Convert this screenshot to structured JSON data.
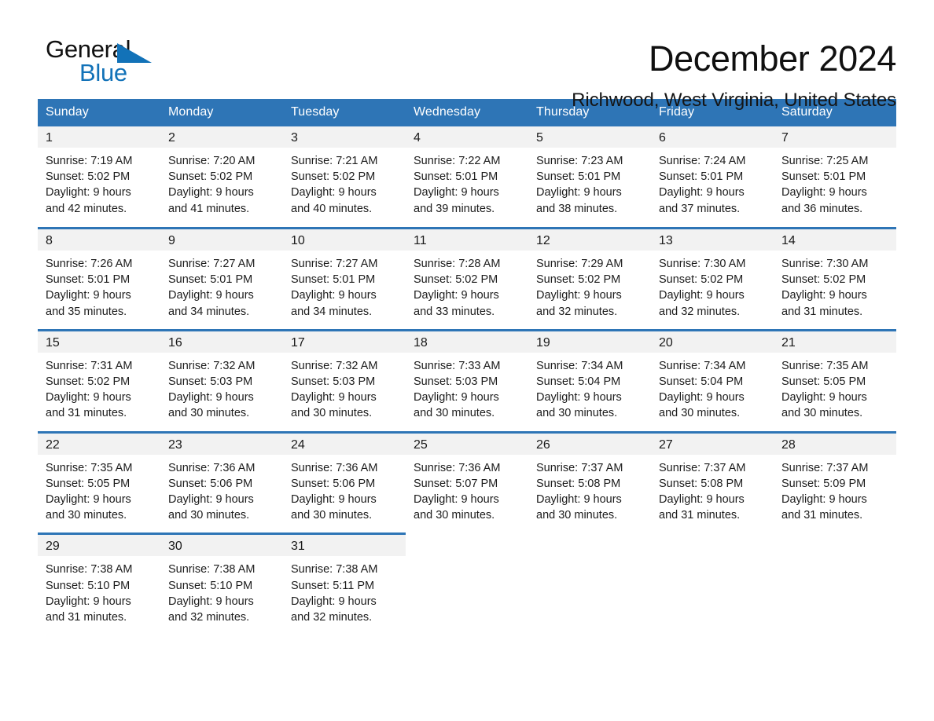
{
  "brand": {
    "word_one": "General",
    "word_two": "Blue",
    "accent_color": "#1272b8",
    "triangle_icon": "triangle-icon"
  },
  "header": {
    "month_title": "December 2024",
    "location": "Richwood, West Virginia, United States"
  },
  "theme": {
    "header_bar": "#2e75b6",
    "daynum_band": "#f2f2f2",
    "divider": "#2e75b6",
    "text": "#1a1a1a"
  },
  "weekday_headers": [
    "Sunday",
    "Monday",
    "Tuesday",
    "Wednesday",
    "Thursday",
    "Friday",
    "Saturday"
  ],
  "weeks": [
    [
      {
        "day": "1",
        "sunrise": "Sunrise: 7:19 AM",
        "sunset": "Sunset: 5:02 PM",
        "daylight_1": "Daylight: 9 hours",
        "daylight_2": "and 42 minutes."
      },
      {
        "day": "2",
        "sunrise": "Sunrise: 7:20 AM",
        "sunset": "Sunset: 5:02 PM",
        "daylight_1": "Daylight: 9 hours",
        "daylight_2": "and 41 minutes."
      },
      {
        "day": "3",
        "sunrise": "Sunrise: 7:21 AM",
        "sunset": "Sunset: 5:02 PM",
        "daylight_1": "Daylight: 9 hours",
        "daylight_2": "and 40 minutes."
      },
      {
        "day": "4",
        "sunrise": "Sunrise: 7:22 AM",
        "sunset": "Sunset: 5:01 PM",
        "daylight_1": "Daylight: 9 hours",
        "daylight_2": "and 39 minutes."
      },
      {
        "day": "5",
        "sunrise": "Sunrise: 7:23 AM",
        "sunset": "Sunset: 5:01 PM",
        "daylight_1": "Daylight: 9 hours",
        "daylight_2": "and 38 minutes."
      },
      {
        "day": "6",
        "sunrise": "Sunrise: 7:24 AM",
        "sunset": "Sunset: 5:01 PM",
        "daylight_1": "Daylight: 9 hours",
        "daylight_2": "and 37 minutes."
      },
      {
        "day": "7",
        "sunrise": "Sunrise: 7:25 AM",
        "sunset": "Sunset: 5:01 PM",
        "daylight_1": "Daylight: 9 hours",
        "daylight_2": "and 36 minutes."
      }
    ],
    [
      {
        "day": "8",
        "sunrise": "Sunrise: 7:26 AM",
        "sunset": "Sunset: 5:01 PM",
        "daylight_1": "Daylight: 9 hours",
        "daylight_2": "and 35 minutes."
      },
      {
        "day": "9",
        "sunrise": "Sunrise: 7:27 AM",
        "sunset": "Sunset: 5:01 PM",
        "daylight_1": "Daylight: 9 hours",
        "daylight_2": "and 34 minutes."
      },
      {
        "day": "10",
        "sunrise": "Sunrise: 7:27 AM",
        "sunset": "Sunset: 5:01 PM",
        "daylight_1": "Daylight: 9 hours",
        "daylight_2": "and 34 minutes."
      },
      {
        "day": "11",
        "sunrise": "Sunrise: 7:28 AM",
        "sunset": "Sunset: 5:02 PM",
        "daylight_1": "Daylight: 9 hours",
        "daylight_2": "and 33 minutes."
      },
      {
        "day": "12",
        "sunrise": "Sunrise: 7:29 AM",
        "sunset": "Sunset: 5:02 PM",
        "daylight_1": "Daylight: 9 hours",
        "daylight_2": "and 32 minutes."
      },
      {
        "day": "13",
        "sunrise": "Sunrise: 7:30 AM",
        "sunset": "Sunset: 5:02 PM",
        "daylight_1": "Daylight: 9 hours",
        "daylight_2": "and 32 minutes."
      },
      {
        "day": "14",
        "sunrise": "Sunrise: 7:30 AM",
        "sunset": "Sunset: 5:02 PM",
        "daylight_1": "Daylight: 9 hours",
        "daylight_2": "and 31 minutes."
      }
    ],
    [
      {
        "day": "15",
        "sunrise": "Sunrise: 7:31 AM",
        "sunset": "Sunset: 5:02 PM",
        "daylight_1": "Daylight: 9 hours",
        "daylight_2": "and 31 minutes."
      },
      {
        "day": "16",
        "sunrise": "Sunrise: 7:32 AM",
        "sunset": "Sunset: 5:03 PM",
        "daylight_1": "Daylight: 9 hours",
        "daylight_2": "and 30 minutes."
      },
      {
        "day": "17",
        "sunrise": "Sunrise: 7:32 AM",
        "sunset": "Sunset: 5:03 PM",
        "daylight_1": "Daylight: 9 hours",
        "daylight_2": "and 30 minutes."
      },
      {
        "day": "18",
        "sunrise": "Sunrise: 7:33 AM",
        "sunset": "Sunset: 5:03 PM",
        "daylight_1": "Daylight: 9 hours",
        "daylight_2": "and 30 minutes."
      },
      {
        "day": "19",
        "sunrise": "Sunrise: 7:34 AM",
        "sunset": "Sunset: 5:04 PM",
        "daylight_1": "Daylight: 9 hours",
        "daylight_2": "and 30 minutes."
      },
      {
        "day": "20",
        "sunrise": "Sunrise: 7:34 AM",
        "sunset": "Sunset: 5:04 PM",
        "daylight_1": "Daylight: 9 hours",
        "daylight_2": "and 30 minutes."
      },
      {
        "day": "21",
        "sunrise": "Sunrise: 7:35 AM",
        "sunset": "Sunset: 5:05 PM",
        "daylight_1": "Daylight: 9 hours",
        "daylight_2": "and 30 minutes."
      }
    ],
    [
      {
        "day": "22",
        "sunrise": "Sunrise: 7:35 AM",
        "sunset": "Sunset: 5:05 PM",
        "daylight_1": "Daylight: 9 hours",
        "daylight_2": "and 30 minutes."
      },
      {
        "day": "23",
        "sunrise": "Sunrise: 7:36 AM",
        "sunset": "Sunset: 5:06 PM",
        "daylight_1": "Daylight: 9 hours",
        "daylight_2": "and 30 minutes."
      },
      {
        "day": "24",
        "sunrise": "Sunrise: 7:36 AM",
        "sunset": "Sunset: 5:06 PM",
        "daylight_1": "Daylight: 9 hours",
        "daylight_2": "and 30 minutes."
      },
      {
        "day": "25",
        "sunrise": "Sunrise: 7:36 AM",
        "sunset": "Sunset: 5:07 PM",
        "daylight_1": "Daylight: 9 hours",
        "daylight_2": "and 30 minutes."
      },
      {
        "day": "26",
        "sunrise": "Sunrise: 7:37 AM",
        "sunset": "Sunset: 5:08 PM",
        "daylight_1": "Daylight: 9 hours",
        "daylight_2": "and 30 minutes."
      },
      {
        "day": "27",
        "sunrise": "Sunrise: 7:37 AM",
        "sunset": "Sunset: 5:08 PM",
        "daylight_1": "Daylight: 9 hours",
        "daylight_2": "and 31 minutes."
      },
      {
        "day": "28",
        "sunrise": "Sunrise: 7:37 AM",
        "sunset": "Sunset: 5:09 PM",
        "daylight_1": "Daylight: 9 hours",
        "daylight_2": "and 31 minutes."
      }
    ],
    [
      {
        "day": "29",
        "sunrise": "Sunrise: 7:38 AM",
        "sunset": "Sunset: 5:10 PM",
        "daylight_1": "Daylight: 9 hours",
        "daylight_2": "and 31 minutes."
      },
      {
        "day": "30",
        "sunrise": "Sunrise: 7:38 AM",
        "sunset": "Sunset: 5:10 PM",
        "daylight_1": "Daylight: 9 hours",
        "daylight_2": "and 32 minutes."
      },
      {
        "day": "31",
        "sunrise": "Sunrise: 7:38 AM",
        "sunset": "Sunset: 5:11 PM",
        "daylight_1": "Daylight: 9 hours",
        "daylight_2": "and 32 minutes."
      },
      {
        "day": "",
        "sunrise": "",
        "sunset": "",
        "daylight_1": "",
        "daylight_2": ""
      },
      {
        "day": "",
        "sunrise": "",
        "sunset": "",
        "daylight_1": "",
        "daylight_2": ""
      },
      {
        "day": "",
        "sunrise": "",
        "sunset": "",
        "daylight_1": "",
        "daylight_2": ""
      },
      {
        "day": "",
        "sunrise": "",
        "sunset": "",
        "daylight_1": "",
        "daylight_2": ""
      }
    ]
  ]
}
